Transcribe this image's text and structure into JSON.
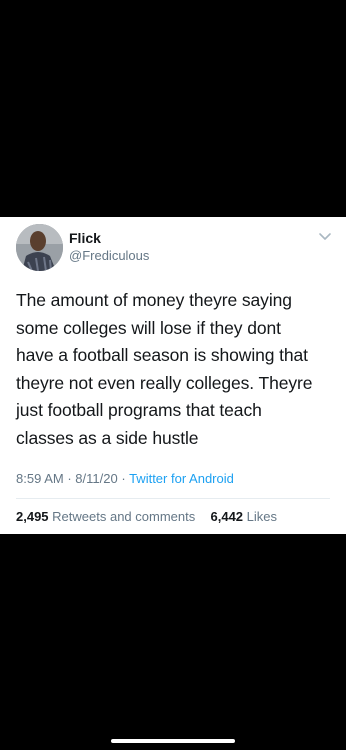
{
  "tweet": {
    "author_name": "Flick",
    "author_handle": "@Frediculous",
    "text_lines": [
      "The amount of money theyre saying",
      "some colleges will lose if they dont",
      "have a football season is showing that",
      "theyre not even really colleges. Theyre",
      "just football programs that teach",
      "classes as a side hustle"
    ],
    "time": "8:59 AM",
    "date": "8/11/20",
    "separator": "·",
    "source": "Twitter for Android",
    "retweets_count": "2,495",
    "retweets_label": "Retweets and comments",
    "likes_count": "6,442",
    "likes_label": "Likes"
  },
  "icons": {
    "menu": "chevron-down-icon",
    "avatar": "profile-photo"
  },
  "colors": {
    "background": "#000000",
    "card": "#ffffff",
    "text": "#14171a",
    "secondary": "#657786",
    "link": "#1da1f2"
  }
}
